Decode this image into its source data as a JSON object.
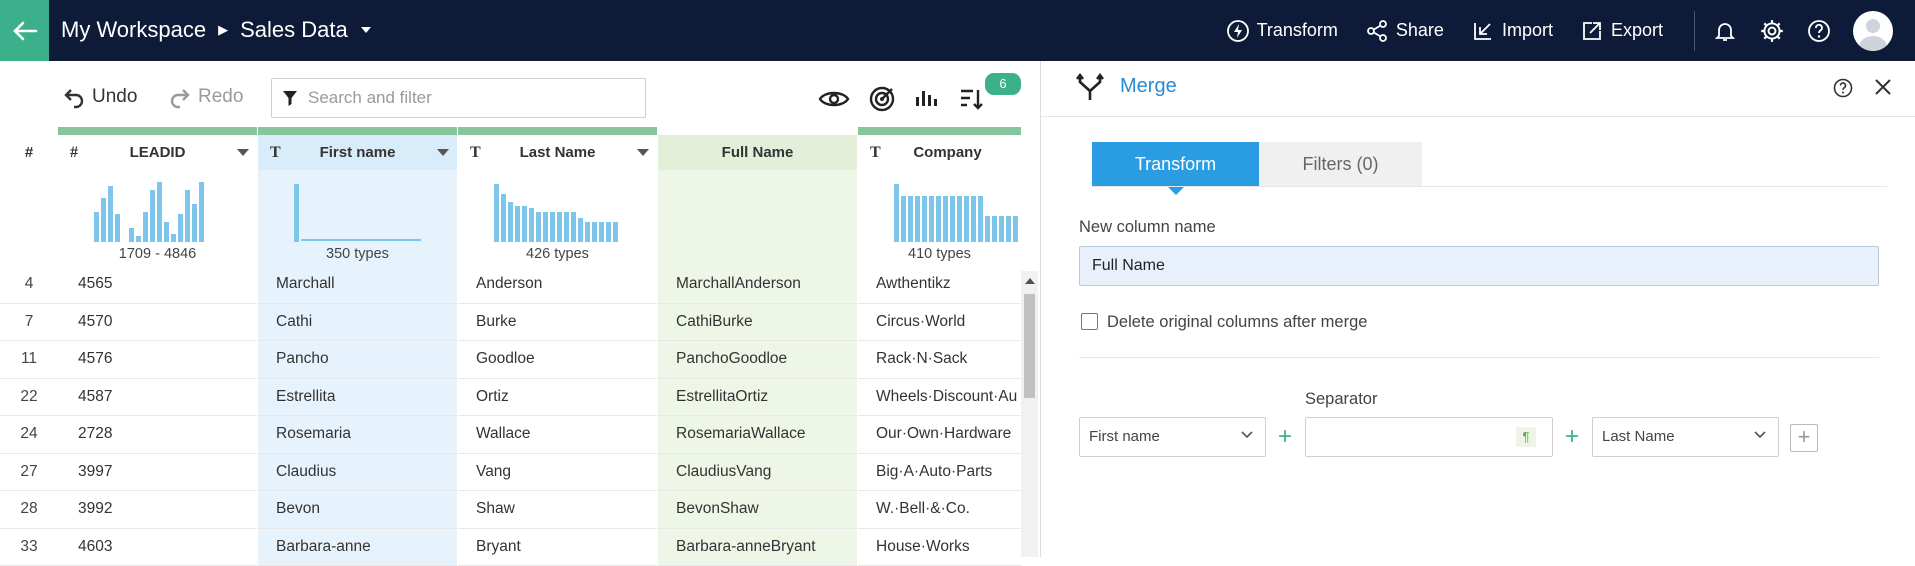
{
  "topbar": {
    "workspace": "My Workspace",
    "dataset": "Sales Data",
    "actions": {
      "transform": "Transform",
      "share": "Share",
      "import": "Import",
      "export": "Export"
    }
  },
  "toolbar": {
    "undo": "Undo",
    "redo": "Redo",
    "search_placeholder": "Search and filter",
    "badge_count": "6"
  },
  "grid": {
    "rownum_header": "#",
    "columns": [
      {
        "type": "#",
        "name": "LEADID",
        "stat": "1709 - 4846"
      },
      {
        "type": "T",
        "name": "First name",
        "stat": "350 types"
      },
      {
        "type": "T",
        "name": "Last Name",
        "stat": "426 types"
      },
      {
        "type": "",
        "name": "Full Name",
        "stat": ""
      },
      {
        "type": "T",
        "name": "Company",
        "stat": "410 types"
      }
    ],
    "rows": [
      {
        "n": "4",
        "leadid": "4565",
        "first": "Marchall",
        "last": "Anderson",
        "full": "MarchallAnderson",
        "company": "Awthentikz"
      },
      {
        "n": "7",
        "leadid": "4570",
        "first": "Cathi",
        "last": "Burke",
        "full": "CathiBurke",
        "company": "Circus·World"
      },
      {
        "n": "11",
        "leadid": "4576",
        "first": "Pancho",
        "last": "Goodloe",
        "full": "PanchoGoodloe",
        "company": "Rack·N·Sack"
      },
      {
        "n": "22",
        "leadid": "4587",
        "first": "Estrellita",
        "last": "Ortiz",
        "full": "EstrellitaOrtiz",
        "company": "Wheels·Discount·Au"
      },
      {
        "n": "24",
        "leadid": "2728",
        "first": "Rosemaria",
        "last": "Wallace",
        "full": "RosemariaWallace",
        "company": "Our·Own·Hardware"
      },
      {
        "n": "27",
        "leadid": "3997",
        "first": "Claudius",
        "last": "Vang",
        "full": "ClaudiusVang",
        "company": "Big·A·Auto·Parts"
      },
      {
        "n": "28",
        "leadid": "3992",
        "first": "Bevon",
        "last": "Shaw",
        "full": "BevonShaw",
        "company": "W.·Bell·&·Co."
      },
      {
        "n": "33",
        "leadid": "4603",
        "first": "Barbara-anne",
        "last": "Bryant",
        "full": "Barbara-anneBryant",
        "company": "House·Works"
      }
    ]
  },
  "panel": {
    "title": "Merge",
    "tabs": {
      "transform": "Transform",
      "filters": "Filters (0)"
    },
    "new_column_label": "New column name",
    "new_column_value": "Full Name",
    "delete_label": "Delete original columns after merge",
    "separator_label": "Separator",
    "first_select": "First name",
    "second_select": "Last Name",
    "plus1": "+",
    "plus2": "+",
    "add": "+",
    "pilcrow": "¶"
  },
  "colors": {
    "topbar": "#0e1b38",
    "accent_green": "#3bb08a",
    "accent_blue": "#2a9de2",
    "first_col_bg": "#e7f3fc",
    "full_col_bg": "#eef6e8",
    "bar": "#7ec5ea"
  },
  "icons": [
    "back-arrow-icon",
    "caret-down-icon",
    "transform-icon",
    "share-icon",
    "import-icon",
    "export-icon",
    "bell-icon",
    "gear-icon",
    "help-icon",
    "undo-icon",
    "redo-icon",
    "filter-icon",
    "eye-icon",
    "target-icon",
    "chart-icon",
    "sort-icon",
    "merge-icon",
    "close-icon",
    "chevron-down-icon"
  ]
}
